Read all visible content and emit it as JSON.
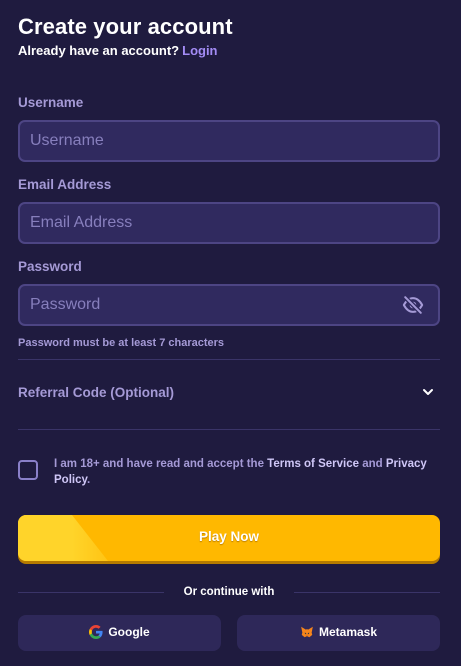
{
  "header": {
    "title": "Create your account",
    "subtitle": "Already have an account?",
    "login_link": "Login"
  },
  "form": {
    "username": {
      "label": "Username",
      "placeholder": "Username",
      "value": ""
    },
    "email": {
      "label": "Email Address",
      "placeholder": "Email Address",
      "value": ""
    },
    "password": {
      "label": "Password",
      "placeholder": "Password",
      "value": "",
      "toggle_icon": "eye-off-icon",
      "hint": "Password must be at least 7 characters"
    },
    "referral": {
      "label": "Referral Code (Optional)",
      "icon": "chevron-down-icon"
    },
    "terms": {
      "prefix": "I am 18+ and have read and accept the",
      "terms_link": "Terms of Service",
      "and": "and",
      "privacy_link": "Privacy Policy",
      "suffix": ".",
      "checked": false
    }
  },
  "actions": {
    "play_label": "Play Now",
    "or_text": "Or continue with",
    "google_label": "Google",
    "metamask_label": "Metamask"
  },
  "colors": {
    "background": "#1f1b3f",
    "field_bg": "#302a5f",
    "field_border": "#4d4584",
    "label": "#a59ad6",
    "accent_link": "#a38cf5",
    "play_button": "#ffb800",
    "social_button": "#2e2859"
  }
}
